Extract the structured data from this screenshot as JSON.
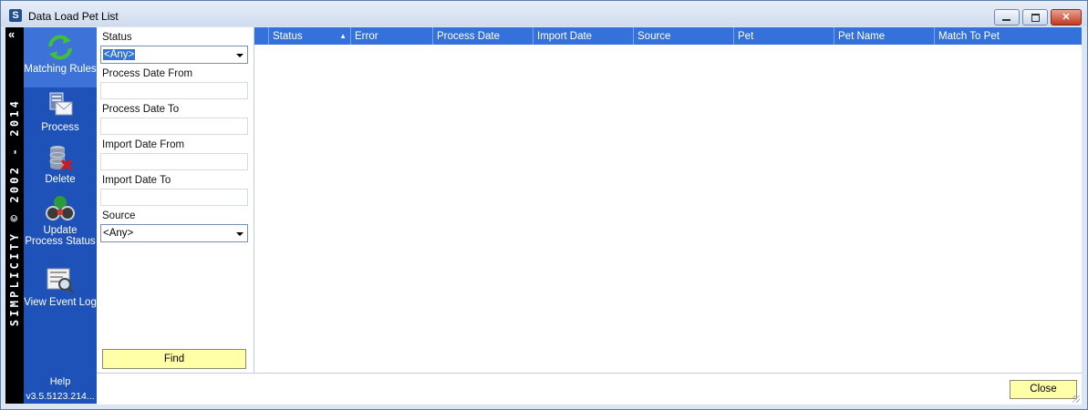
{
  "window": {
    "title": "Data Load Pet List",
    "app_icon_letter": "S",
    "controls": {
      "minimize": "minimize",
      "maximize": "maximize",
      "close": "✕"
    }
  },
  "sidebar": {
    "collapse_glyph": "«",
    "brand": "SIMPLICITY © 2002 - 2014",
    "items": [
      {
        "label": "Matching Rules",
        "icon": "refresh-arrows-icon",
        "active": true
      },
      {
        "label": "Process",
        "icon": "process-mail-icon",
        "active": false
      },
      {
        "label": "Delete",
        "icon": "database-delete-icon",
        "active": false
      },
      {
        "label": "Update Process Status",
        "icon": "binoculars-icon",
        "active": false
      },
      {
        "label": "View Event Log",
        "icon": "log-magnifier-icon",
        "active": false
      }
    ],
    "help": "Help",
    "version": "v3.5.5123.214..."
  },
  "filters": {
    "status": {
      "label": "Status",
      "value": "<Any>"
    },
    "process_date_from": {
      "label": "Process Date From",
      "value": ""
    },
    "process_date_to": {
      "label": "Process Date To",
      "value": ""
    },
    "import_date_from": {
      "label": "Import Date From",
      "value": ""
    },
    "import_date_to": {
      "label": "Import Date To",
      "value": ""
    },
    "source": {
      "label": "Source",
      "value": "<Any>"
    },
    "find_label": "Find"
  },
  "grid": {
    "columns": [
      "Status",
      "Error",
      "Process Date",
      "Import Date",
      "Source",
      "Pet",
      "Pet Name",
      "Match To Pet"
    ],
    "sort_indicator": "▲",
    "rows": []
  },
  "footer": {
    "close_label": "Close"
  },
  "colors": {
    "sidebar": "#1e52b8",
    "header": "#3471db",
    "button": "#ffffa8"
  }
}
